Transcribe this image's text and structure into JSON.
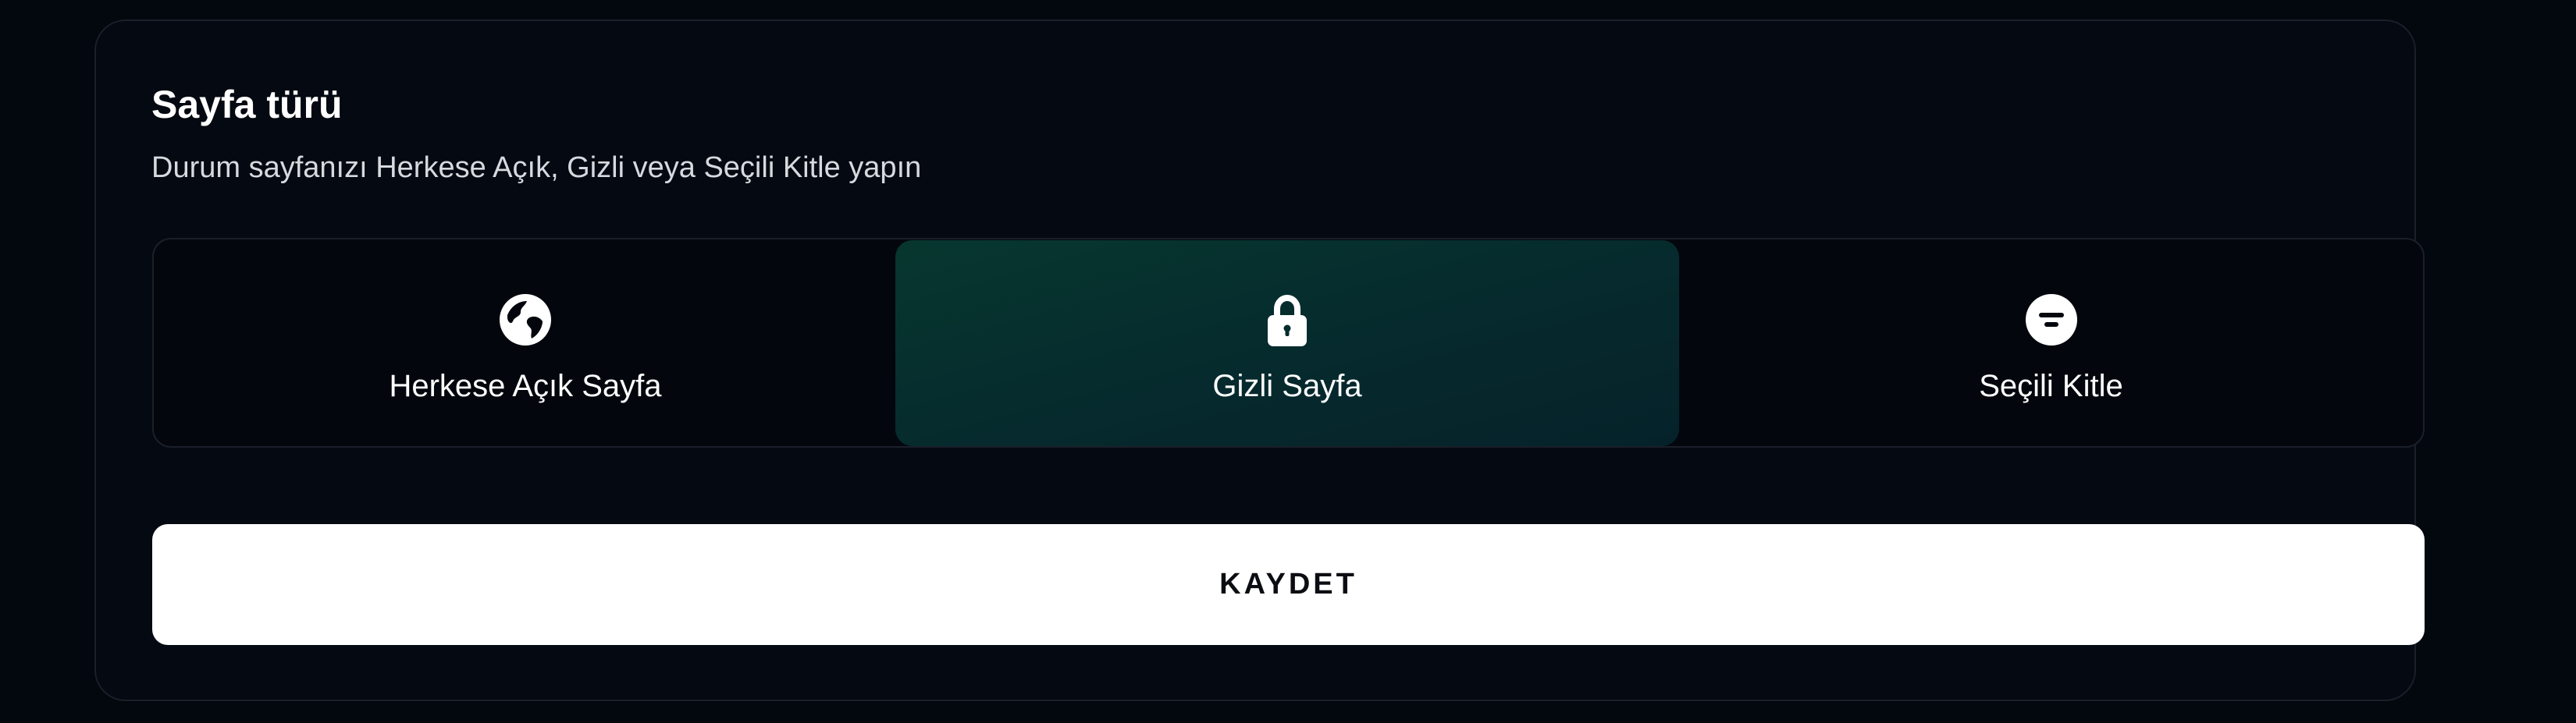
{
  "section": {
    "title": "Sayfa türü",
    "description": "Durum sayfanızı Herkese Açık, Gizli veya Seçili Kitle yapın"
  },
  "page_type_options": [
    {
      "label": "Herkese Açık Sayfa",
      "icon": "globe-icon",
      "selected": false
    },
    {
      "label": "Gizli Sayfa",
      "icon": "lock-icon",
      "selected": true
    },
    {
      "label": "Seçili Kitle",
      "icon": "filter-icon",
      "selected": false
    }
  ],
  "save_button": {
    "label": "KAYDET"
  },
  "colors": {
    "background": "#03070e",
    "selected_option": "#07372f",
    "button_bg": "#ffffff",
    "button_text": "#0b0d12"
  }
}
